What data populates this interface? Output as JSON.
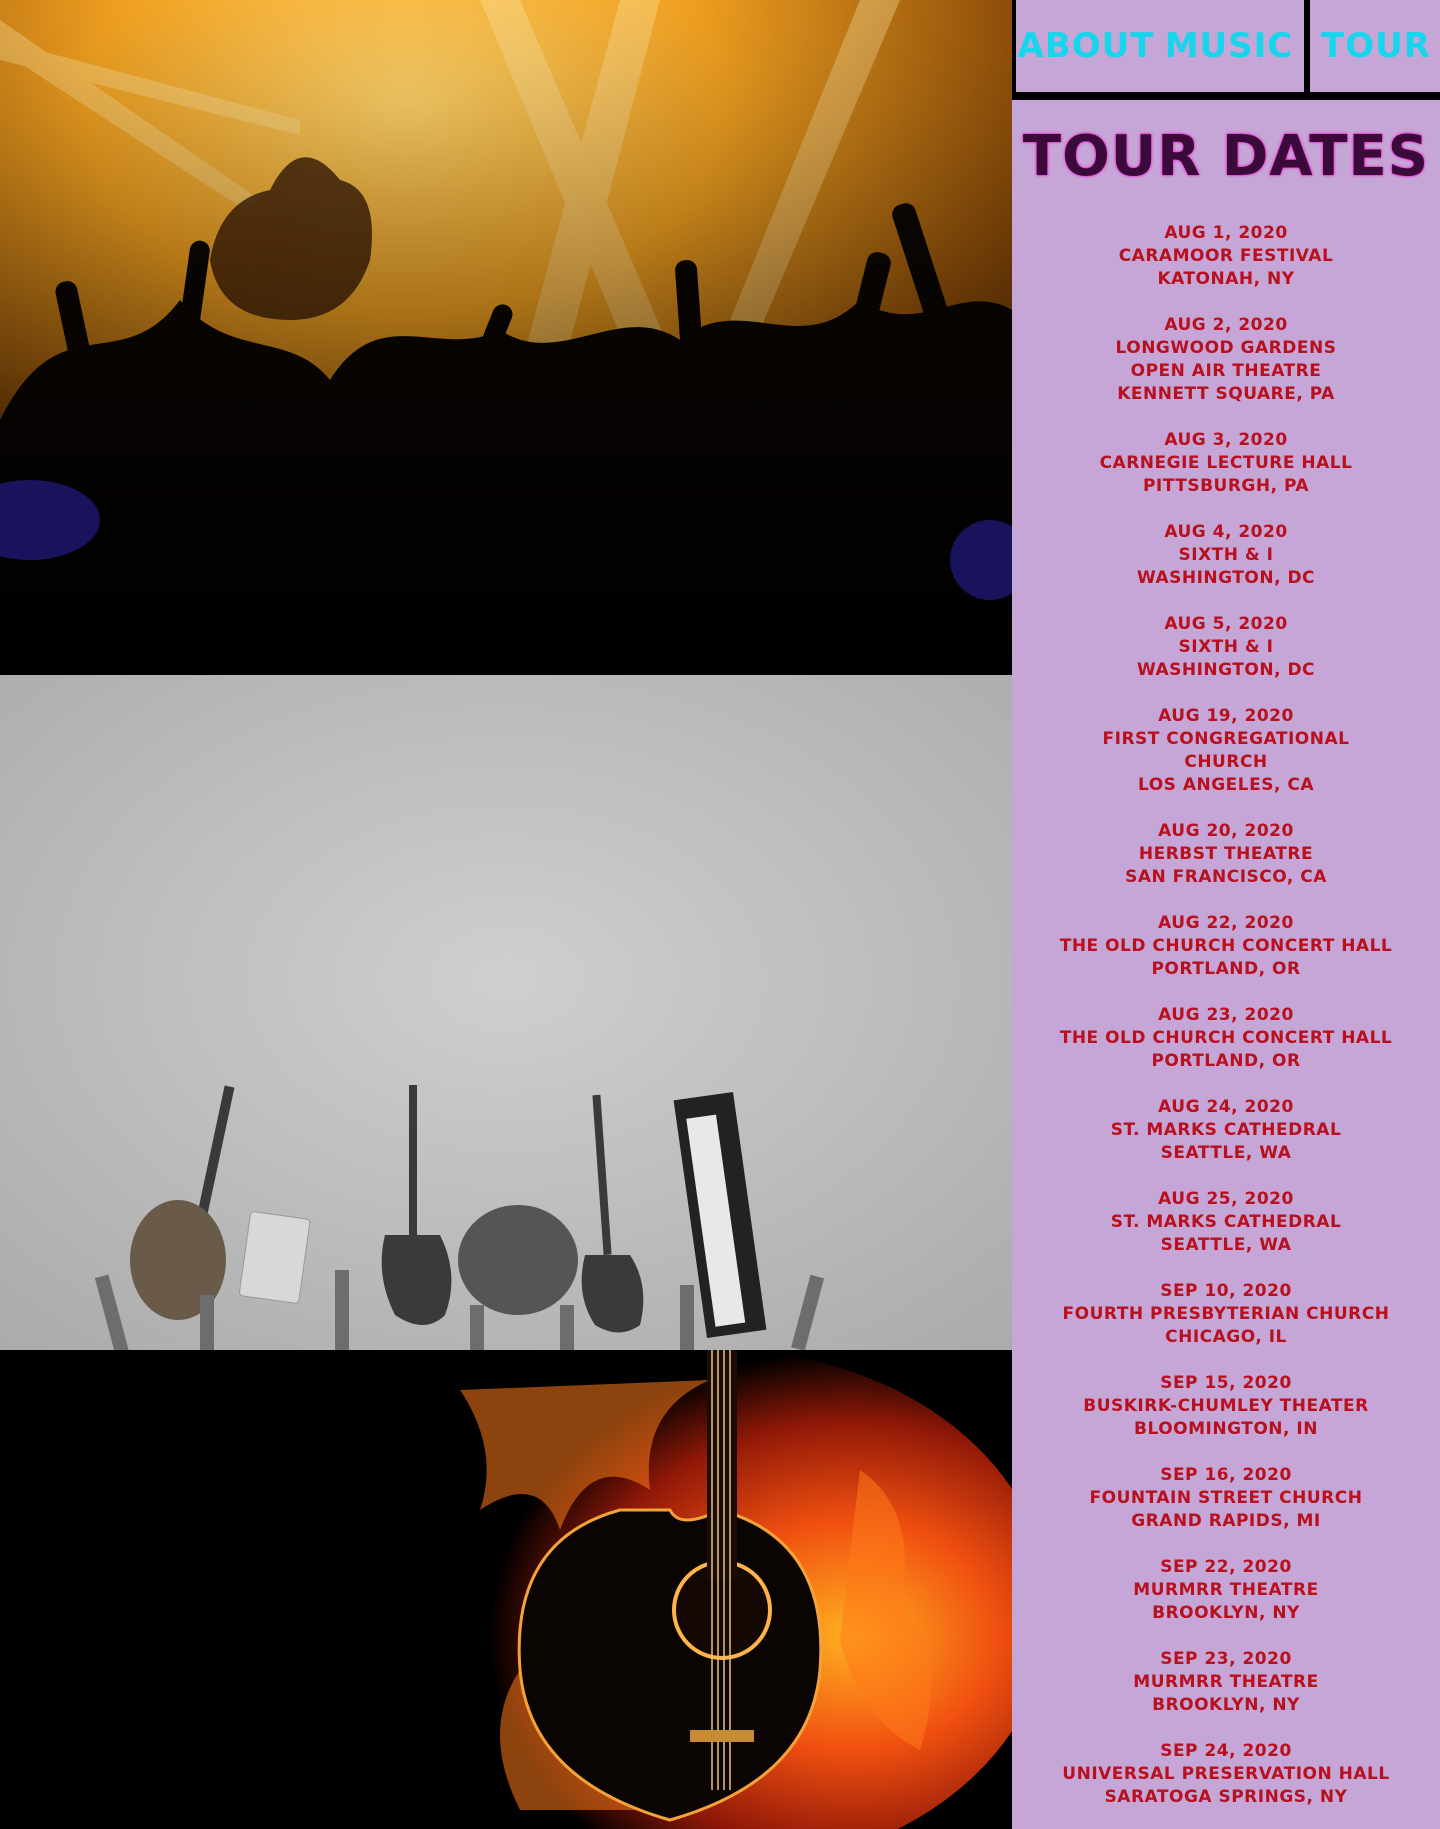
{
  "nav": {
    "items": [
      {
        "label": "ABOUT"
      },
      {
        "label": "MUSIC"
      },
      {
        "label": "TOUR"
      }
    ]
  },
  "colors": {
    "panel_background": "#c5a6d7",
    "nav_text": "#16d6ee",
    "date_text": "#b8101e",
    "title_text": "#3a0b3a"
  },
  "images": [
    {
      "name": "concert-crowd-photo"
    },
    {
      "name": "instruments-held-up-photo"
    },
    {
      "name": "guitar-on-fire-photo"
    }
  ],
  "tour": {
    "title": "TOUR DATES",
    "dates": [
      {
        "date": "AUG 1, 2020",
        "lines": [
          "CARAMOOR FESTIVAL",
          "KATONAH, NY"
        ]
      },
      {
        "date": "AUG 2, 2020",
        "lines": [
          "LONGWOOD GARDENS",
          "OPEN AIR THEATRE",
          "KENNETT SQUARE, PA"
        ]
      },
      {
        "date": "AUG 3, 2020",
        "lines": [
          "CARNEGIE LECTURE HALL",
          "PITTSBURGH, PA"
        ]
      },
      {
        "date": "AUG 4, 2020",
        "lines": [
          "SIXTH & I",
          "WASHINGTON, DC"
        ]
      },
      {
        "date": "AUG 5, 2020",
        "lines": [
          "SIXTH & I",
          "WASHINGTON, DC"
        ]
      },
      {
        "date": "AUG 19, 2020",
        "lines": [
          "FIRST CONGREGATIONAL",
          "CHURCH",
          "LOS ANGELES, CA"
        ]
      },
      {
        "date": "AUG 20, 2020",
        "lines": [
          "HERBST THEATRE",
          "SAN FRANCISCO, CA"
        ]
      },
      {
        "date": "AUG 22, 2020",
        "lines": [
          "THE OLD CHURCH CONCERT HALL",
          "PORTLAND, OR"
        ]
      },
      {
        "date": "AUG 23, 2020",
        "lines": [
          "THE OLD CHURCH CONCERT HALL",
          "PORTLAND, OR"
        ]
      },
      {
        "date": "AUG 24, 2020",
        "lines": [
          "ST. MARKS CATHEDRAL",
          "SEATTLE, WA"
        ]
      },
      {
        "date": "AUG 25, 2020",
        "lines": [
          "ST. MARKS CATHEDRAL",
          "SEATTLE, WA"
        ]
      },
      {
        "date": "SEP 10, 2020",
        "lines": [
          "FOURTH PRESBYTERIAN CHURCH",
          "CHICAGO, IL"
        ]
      },
      {
        "date": "SEP 15, 2020",
        "lines": [
          "BUSKIRK-CHUMLEY THEATER",
          "BLOOMINGTON, IN"
        ]
      },
      {
        "date": "SEP 16, 2020",
        "lines": [
          "FOUNTAIN STREET CHURCH",
          "GRAND RAPIDS, MI"
        ]
      },
      {
        "date": "SEP 22, 2020",
        "lines": [
          "MURMRR THEATRE",
          "BROOKLYN, NY"
        ]
      },
      {
        "date": "SEP 23, 2020",
        "lines": [
          "MURMRR THEATRE",
          "BROOKLYN, NY"
        ]
      },
      {
        "date": "SEP 24, 2020",
        "lines": [
          "UNIVERSAL PRESERVATION HALL",
          "SARATOGA SPRINGS, NY"
        ]
      }
    ]
  }
}
